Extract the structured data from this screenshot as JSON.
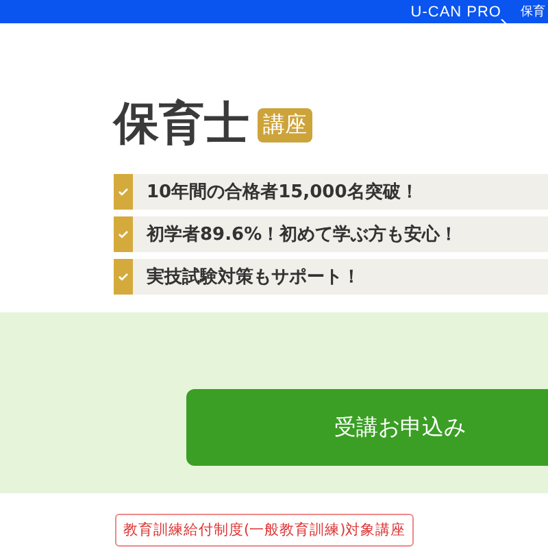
{
  "header": {
    "logo": "U-CAN PRO",
    "nav_item": "保育"
  },
  "title": "保育士",
  "badge": "講座",
  "features": [
    {
      "text": "10年間の合格者15,000名突破！"
    },
    {
      "text": "初学者89.6%！初めて学ぶ方も安心！"
    },
    {
      "text": "実技試験対策もサポート！"
    }
  ],
  "apply_button": "受講お申込み",
  "notice_tag": "教育訓練給付制度(一般教育訓練)対象講座"
}
